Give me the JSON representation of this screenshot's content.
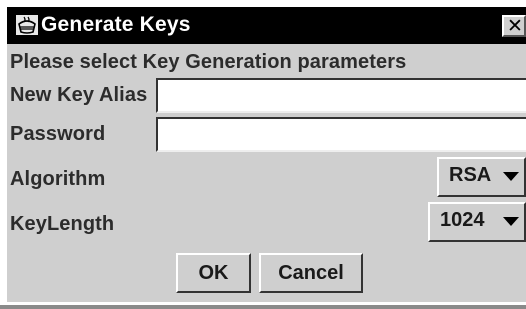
{
  "window": {
    "title": "Generate Keys",
    "close_glyph": "✕",
    "icon": "app-cup-icon"
  },
  "form": {
    "instruction": "Please select Key Generation parameters",
    "alias_label": "New Key Alias",
    "alias_value": "",
    "password_label": "Password",
    "password_value": "",
    "algorithm_label": "Algorithm",
    "algorithm_value": "RSA",
    "keylength_label": "KeyLength",
    "keylength_value": "1024"
  },
  "buttons": {
    "ok": "OK",
    "cancel": "Cancel"
  },
  "colors": {
    "titlebar": "#000000",
    "panel": "#cfcfcf"
  }
}
